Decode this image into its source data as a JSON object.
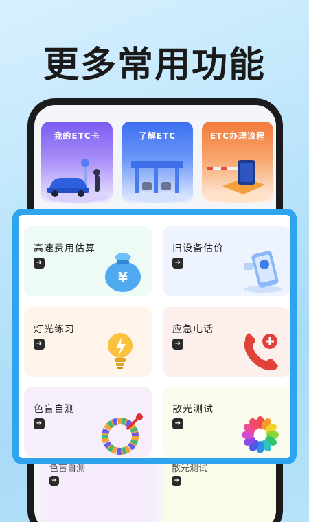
{
  "headline": "更多常用功能",
  "top_cards": [
    {
      "label": "我的ETC卡"
    },
    {
      "label": "了解ETC"
    },
    {
      "label": "ETC办理流程"
    }
  ],
  "features": [
    {
      "label": "高速费用估算",
      "icon": "money-bag-icon"
    },
    {
      "label": "旧设备估价",
      "icon": "phone-valuation-icon"
    },
    {
      "label": "灯光练习",
      "icon": "lightbulb-icon"
    },
    {
      "label": "应急电话",
      "icon": "phone-icon"
    },
    {
      "label": "色盲自测",
      "icon": "color-wheel-icon"
    },
    {
      "label": "散光测试",
      "icon": "flower-icon"
    }
  ],
  "peek_cards": [
    {
      "label": "色盲自测"
    },
    {
      "label": "散光测试"
    }
  ],
  "arrow_glyph": "➔",
  "colors": {
    "accent": "#2ea3ee",
    "phone": "#1b1b1d"
  }
}
